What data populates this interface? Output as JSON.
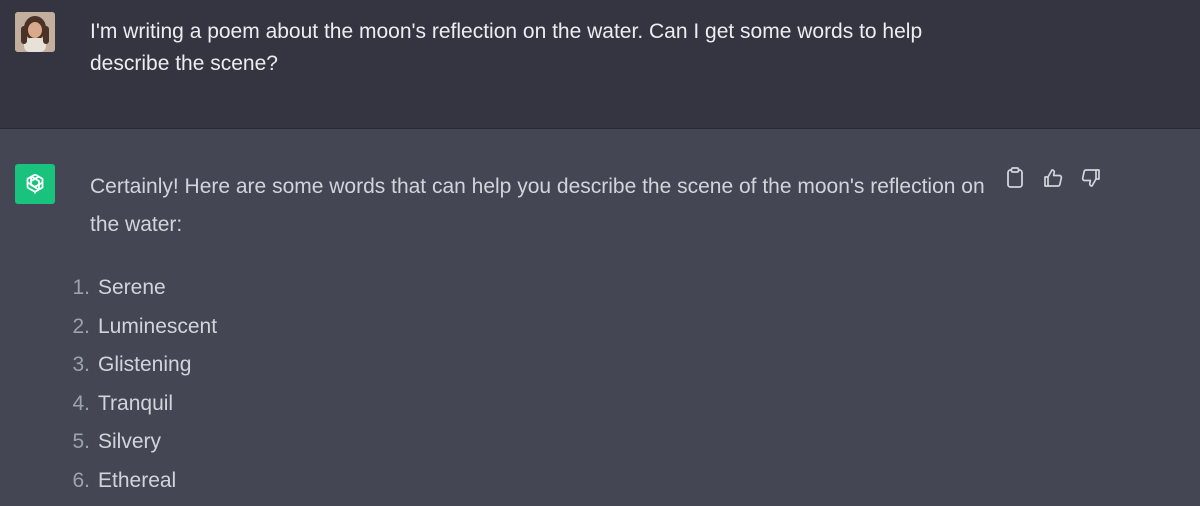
{
  "conversation": {
    "user": {
      "avatar_icon": "user-avatar-photo",
      "message": "I'm writing a poem about the moon's reflection on the water. Can I get some words to help describe the scene?"
    },
    "assistant": {
      "logo_icon": "openai-logo-icon",
      "logo_color": "#19c37d",
      "intro": "Certainly! Here are some words that can help you describe the scene of the moon's reflection on the water:",
      "actions": {
        "copy_icon": "clipboard-icon",
        "thumbs_up_icon": "thumbs-up-icon",
        "thumbs_down_icon": "thumbs-down-icon"
      },
      "items": [
        {
          "num": "1.",
          "word": "Serene"
        },
        {
          "num": "2.",
          "word": "Luminescent"
        },
        {
          "num": "3.",
          "word": "Glistening"
        },
        {
          "num": "4.",
          "word": "Tranquil"
        },
        {
          "num": "5.",
          "word": "Silvery"
        },
        {
          "num": "6.",
          "word": "Ethereal"
        }
      ]
    }
  },
  "colors": {
    "user_bg": "#343541",
    "assistant_bg": "#444654",
    "text": "#d1d5db"
  }
}
